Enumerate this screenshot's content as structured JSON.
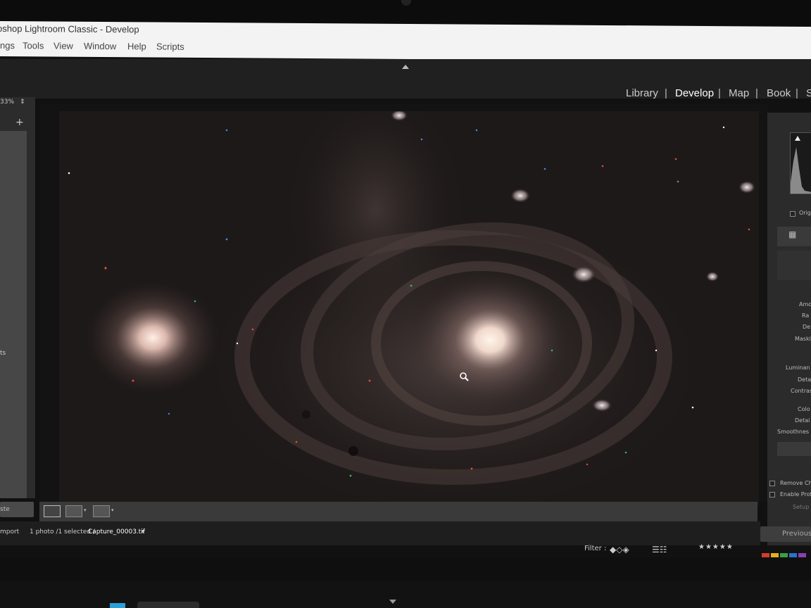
{
  "window": {
    "title": "oshop Lightroom Classic - Develop"
  },
  "menu": [
    "ngs",
    "Tools",
    "View",
    "Window",
    "Help",
    "Scripts"
  ],
  "modules": [
    "Library",
    "Develop",
    "Map",
    "Book",
    "S"
  ],
  "left_panel": {
    "zoom": "33%",
    "side_text": "ts",
    "bottom_button": "ste"
  },
  "filmstrip": {
    "import_label": "mport",
    "status": "1 photo /1 selected /",
    "filename": "Capture_00003.tif"
  },
  "filter": {
    "label": "Filter :",
    "stars": "★★★★★",
    "color_labels": [
      "#d23c2c",
      "#e0b020",
      "#3aa040",
      "#2a70d0",
      "#8a40b0"
    ]
  },
  "right_panel": {
    "orig_label": "Orig",
    "detail_labels": [
      "Amo",
      "Ra",
      "De",
      "Maski"
    ],
    "noise_labels": [
      "Luminan",
      "Deta",
      "Contras",
      "Colo",
      "Detai",
      "Smoothnes"
    ],
    "lens_labels": [
      "Remove Ch",
      "Enable Prof"
    ],
    "setup_label": "Setup",
    "previous_button": "Previous"
  },
  "icons": {
    "collapse_top": "triangle-up-icon",
    "zoom_stepper": "updown-arrows-icon",
    "add": "plus-icon",
    "loupe_cursor": "magnifier-icon",
    "filmstrip_toggle": "triangle-down-icon"
  }
}
